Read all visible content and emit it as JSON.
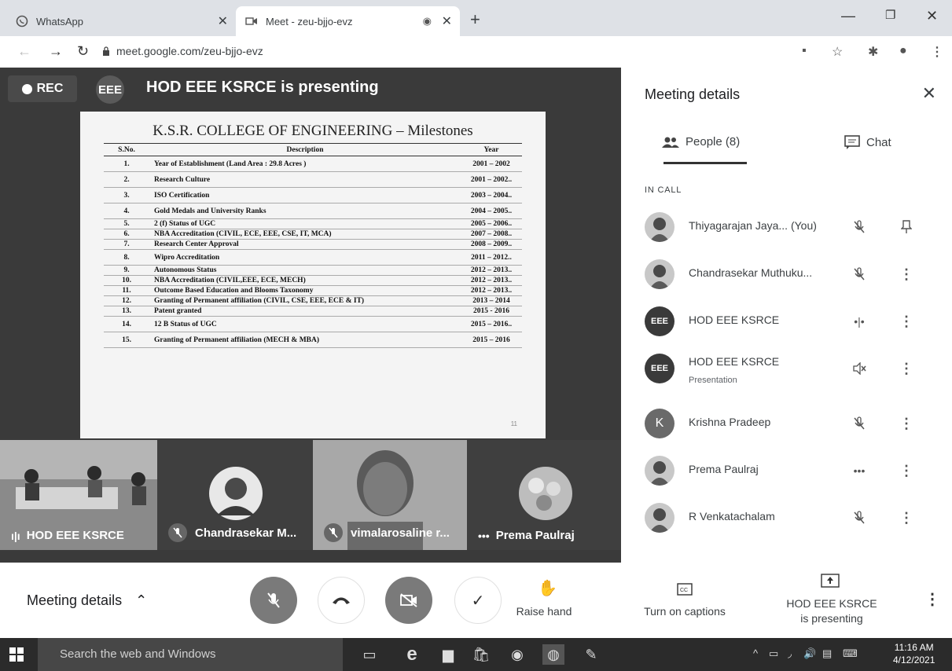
{
  "browser": {
    "tabs": [
      {
        "title": "WhatsApp",
        "icon": "whatsapp-icon",
        "active": false
      },
      {
        "title": "Meet - zeu-bjjo-evz",
        "icon": "meet-icon",
        "active": true
      }
    ],
    "url": "meet.google.com/zeu-bjjo-evz"
  },
  "stage": {
    "rec_label": "REC",
    "presenter_logo": "EEE",
    "presenting_text": "HOD EEE KSRCE is presenting",
    "slide": {
      "title": "K.S.R. COLLEGE OF ENGINEERING – Milestones",
      "headers": [
        "S.No.",
        "Description",
        "Year"
      ],
      "rows": [
        [
          "1.",
          "Year of Establishment (Land Area : 29.8 Acres )",
          "2001 – 2002"
        ],
        [
          "2.",
          "Research Culture",
          "2001 – 2002.."
        ],
        [
          "3.",
          "ISO Certification",
          "2003 – 2004.."
        ],
        [
          "4.",
          "Gold Medals and University Ranks",
          "2004 – 2005.."
        ],
        [
          "5.",
          "2 (f) Status of UGC",
          "2005 – 2006.."
        ],
        [
          "6.",
          "NBA Accreditation (CIVIL, ECE, EEE, CSE, IT, MCA)",
          "2007 – 2008.."
        ],
        [
          "7.",
          "Research Center Approval",
          "2008 – 2009.."
        ],
        [
          "8.",
          "Wipro Accreditation",
          "2011 – 2012.."
        ],
        [
          "9.",
          "Autonomous Status",
          "2012 – 2013.."
        ],
        [
          "10.",
          "NBA Accreditation (CIVIL,EEE, ECE, MECH)",
          "2012 – 2013.."
        ],
        [
          "11.",
          "Outcome Based Education and Blooms Taxonomy",
          "2012 – 2013.."
        ],
        [
          "12.",
          "Granting of Permanent affiliation (CIVIL, CSE, EEE, ECE & IT)",
          "2013 – 2014"
        ],
        [
          "13.",
          "Patent granted",
          "2015 - 2016"
        ],
        [
          "14.",
          "12 B Status of UGC",
          "2015 – 2016.."
        ],
        [
          "15.",
          "Granting of Permanent affiliation (MECH & MBA)",
          "2015 – 2016"
        ]
      ],
      "page": "11"
    },
    "tiles": [
      {
        "name": "HOD EEE KSRCE",
        "indicator": "speaking"
      },
      {
        "name": "Chandrasekar M...",
        "indicator": "muted"
      },
      {
        "name": "vimalarosaline r...",
        "indicator": "muted"
      },
      {
        "name": "Prema Paulraj",
        "indicator": "more"
      }
    ]
  },
  "panel": {
    "title": "Meeting details",
    "tabs": {
      "people": "People (8)",
      "chat": "Chat"
    },
    "section": "IN CALL",
    "people": [
      {
        "name": "Thiyagarajan Jaya... (You)",
        "sub": "",
        "avatar": "",
        "status": "mic-off",
        "action": "pin"
      },
      {
        "name": "Chandrasekar Muthuku...",
        "sub": "",
        "avatar": "",
        "status": "mic-off",
        "action": "more"
      },
      {
        "name": "HOD EEE KSRCE",
        "sub": "",
        "avatar": "EEE",
        "status": "speaking",
        "action": "more"
      },
      {
        "name": "HOD EEE KSRCE",
        "sub": "Presentation",
        "avatar": "EEE",
        "status": "volume-off",
        "action": "more"
      },
      {
        "name": "Krishna Pradeep",
        "sub": "",
        "avatar": "K",
        "status": "mic-off",
        "action": "more"
      },
      {
        "name": "Prema Paulraj",
        "sub": "",
        "avatar": "",
        "status": "dots",
        "action": "more"
      },
      {
        "name": "R Venkatachalam",
        "sub": "",
        "avatar": "",
        "status": "mic-off",
        "action": "more"
      }
    ]
  },
  "controls": {
    "meeting_details": "Meeting details",
    "raise_hand": "Raise hand",
    "captions": "Turn on captions",
    "presenting_line1": "HOD EEE KSRCE",
    "presenting_line2": "is presenting"
  },
  "taskbar": {
    "search_placeholder": "Search the web and Windows",
    "time": "11:16 AM",
    "date": "4/12/2021"
  }
}
